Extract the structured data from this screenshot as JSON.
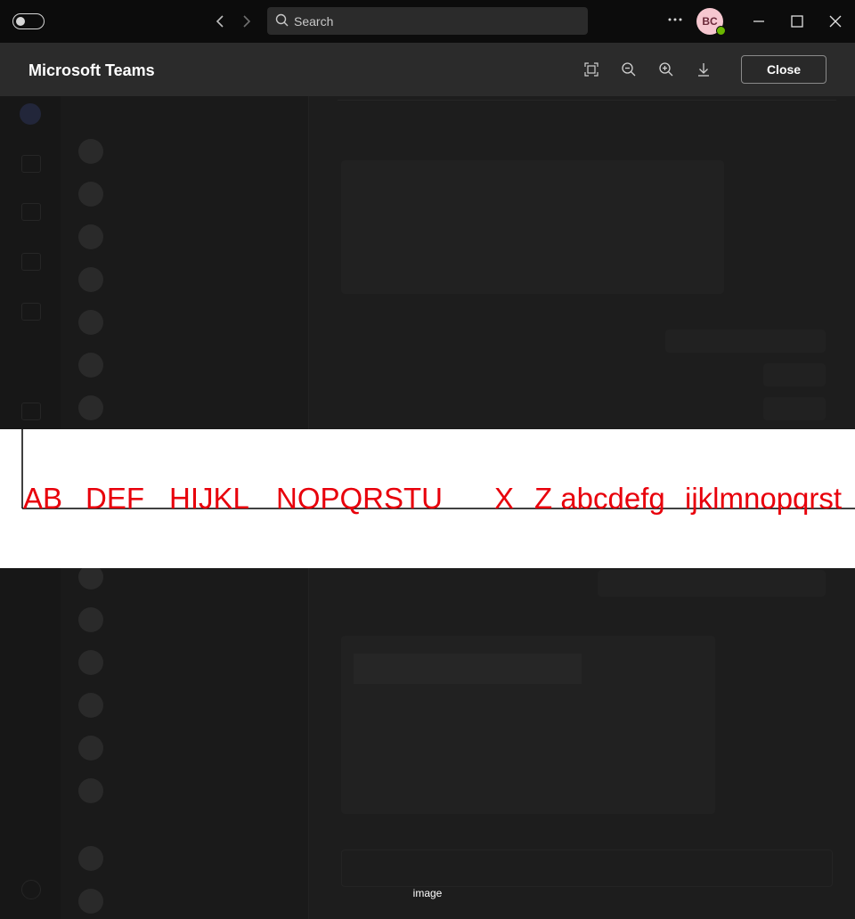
{
  "titlebar": {
    "search_placeholder": "Search",
    "avatar_initials": "BC",
    "back_icon": "chevron-left-icon",
    "forward_icon": "chevron-right-icon"
  },
  "viewer": {
    "title": "Microsoft Teams",
    "close_label": "Close",
    "tools": [
      "fit-to-screen-icon",
      "zoom-out-icon",
      "zoom-in-icon",
      "download-icon"
    ]
  },
  "image": {
    "segments": [
      "AB",
      "DEF",
      "HIJKL",
      "NOPQRSTU",
      "X",
      "Z abcdefg",
      "ijklmnopqrst"
    ],
    "text_color": "#e8000b"
  },
  "caption": "image"
}
